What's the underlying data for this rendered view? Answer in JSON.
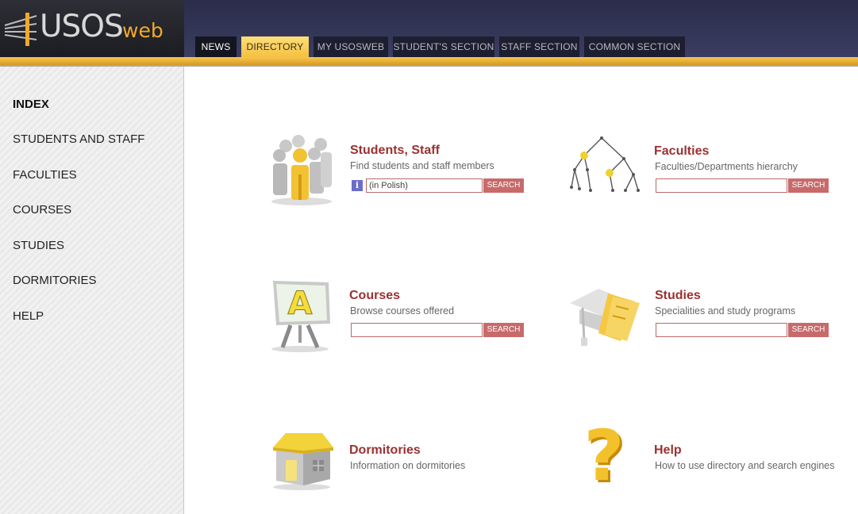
{
  "logo": {
    "main": "USOS",
    "suffix": "web"
  },
  "tabs": [
    {
      "label": "NEWS"
    },
    {
      "label": "DIRECTORY"
    },
    {
      "label": "MY USOSWEB"
    },
    {
      "label": "STUDENT'S SECTION"
    },
    {
      "label": "STAFF SECTION"
    },
    {
      "label": "COMMON SECTION"
    }
  ],
  "sidebar": {
    "items": [
      {
        "label": "INDEX"
      },
      {
        "label": "STUDENTS AND STAFF"
      },
      {
        "label": "FACULTIES"
      },
      {
        "label": "COURSES"
      },
      {
        "label": "STUDIES"
      },
      {
        "label": "DORMITORIES"
      },
      {
        "label": "HELP"
      }
    ]
  },
  "entries": {
    "students": {
      "title": "Students, Staff",
      "desc": "Find students and staff members",
      "value": "(in Polish)",
      "button": "SEARCH",
      "info": "i",
      "icon": "people-icon"
    },
    "faculties": {
      "title": "Faculties",
      "desc": "Faculties/Departments hierarchy",
      "value": "",
      "button": "SEARCH",
      "icon": "tree-hierarchy-icon"
    },
    "courses": {
      "title": "Courses",
      "desc": "Browse courses offered",
      "value": "",
      "button": "SEARCH",
      "icon": "easel-icon"
    },
    "studies": {
      "title": "Studies",
      "desc": "Specialities and study programs",
      "value": "",
      "button": "SEARCH",
      "icon": "graduation-cap-icon"
    },
    "dormitories": {
      "title": "Dormitories",
      "desc": "Information on dormitories",
      "icon": "house-icon"
    },
    "help": {
      "title": "Help",
      "desc": "How to use directory and search engines",
      "icon": "question-mark-icon"
    }
  },
  "colors": {
    "accent": "#9b3131",
    "tab_active": "#f5c040",
    "header_bg": "#2a2c49",
    "button": "#c86a6a"
  }
}
